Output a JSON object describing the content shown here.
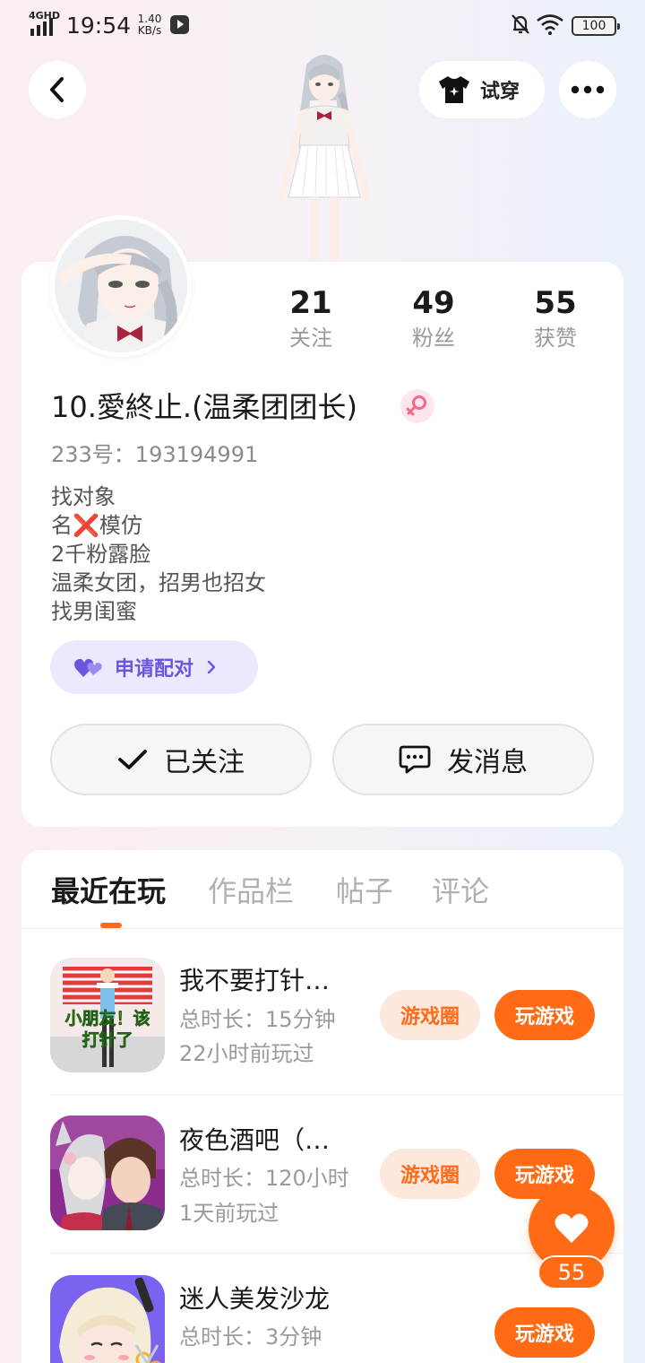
{
  "status_bar": {
    "network": "4GHD",
    "time": "19:54",
    "speed_value": "1.40",
    "speed_unit": "KB/s",
    "battery": "100"
  },
  "header": {
    "try_on_label": "试穿"
  },
  "profile": {
    "stats": [
      {
        "value": "21",
        "label": "关注"
      },
      {
        "value": "49",
        "label": "粉丝"
      },
      {
        "value": "55",
        "label": "获赞"
      }
    ],
    "nickname": "10.愛終止.(温柔团团长)",
    "user_id": "233号：193194991",
    "bio": [
      "找对象",
      "名❌模仿",
      "2千粉露脸",
      "温柔女团，招男也招女",
      "找男闺蜜"
    ],
    "pair_label": "申请配对",
    "follow_label": "已关注",
    "message_label": "发消息"
  },
  "tabs": [
    "最近在玩",
    "作品栏",
    "帖子",
    "评论"
  ],
  "games": [
    {
      "name": "我不要打针…",
      "duration": "总时长：15分钟",
      "last_played": "22小时前玩过",
      "icon_text": "小朋友！该打针了",
      "circle_label": "游戏圈",
      "play_label": "玩游戏"
    },
    {
      "name": "夜色酒吧（…",
      "duration": "总时长：120小时",
      "last_played": "1天前玩过",
      "circle_label": "游戏圈",
      "play_label": "玩游戏"
    },
    {
      "name": "迷人美发沙龙",
      "duration": "总时长：3分钟",
      "play_label": "玩游戏"
    }
  ],
  "like_count": "55",
  "colors": {
    "accent": "#ff6b14",
    "pair_accent": "#6a55e0",
    "page_bg_left": "#fbeef0",
    "page_bg_right": "#eaf1fb"
  },
  "icons": {
    "back": "back-chevron-icon",
    "shirt": "shirt-icon",
    "more": "more-dots-icon",
    "gender": "female-gender-icon",
    "heart_pair": "double-heart-icon",
    "check": "check-icon",
    "chat": "chat-bubble-icon",
    "like": "heart-icon"
  }
}
